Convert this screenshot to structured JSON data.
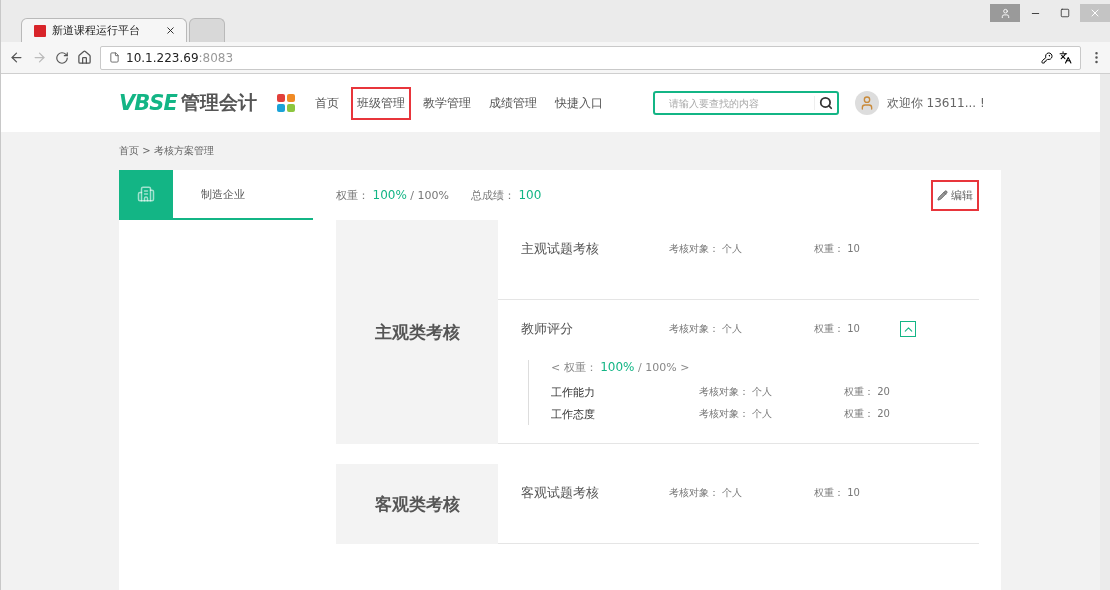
{
  "browser": {
    "tabs": [
      {
        "title": "新道课程运行平台",
        "selected": true
      },
      {
        "selected": false
      }
    ],
    "address": {
      "host": "10.1.223.69",
      "port": ":8083"
    }
  },
  "header": {
    "logo": {
      "brand": "VBSE",
      "name": "管理会计"
    },
    "nav": [
      {
        "label": "首页",
        "highlighted": false
      },
      {
        "label": "班级管理",
        "highlighted": true
      },
      {
        "label": "教学管理",
        "highlighted": false
      },
      {
        "label": "成绩管理",
        "highlighted": false
      },
      {
        "label": "快捷入口",
        "highlighted": false
      }
    ],
    "search": {
      "placeholder": "请输入要查找的内容"
    },
    "welcome": "欢迎你 13611... !"
  },
  "breadcrumb": "首页 > 考核方案管理",
  "sidebar": {
    "items": [
      {
        "label": "制造企业",
        "selected": true
      }
    ]
  },
  "summary": {
    "weight_label": "权重：",
    "weight_value": "100%",
    "weight_total": "/ 100%",
    "score_label": "总成绩：",
    "score_value": "100"
  },
  "edit_button": {
    "label": "编辑",
    "highlighted": true
  },
  "groups": [
    {
      "title": "主观类考核",
      "items": [
        {
          "name": "主观试题考核",
          "target_label": "考核对象：",
          "target": "个人",
          "weight_label": "权重：",
          "weight": "10"
        },
        {
          "name": "教师评分",
          "target_label": "考核对象：",
          "target": "个人",
          "weight_label": "权重：",
          "weight": "10",
          "expanded": true,
          "sub": {
            "weight_open": "< 权重：",
            "weight_value": "100%",
            "weight_close": "/ 100% >",
            "children": [
              {
                "name": "工作能力",
                "target_label": "考核对象：",
                "target": "个人",
                "weight_label": "权重：",
                "weight": "20"
              },
              {
                "name": "工作态度",
                "target_label": "考核对象：",
                "target": "个人",
                "weight_label": "权重：",
                "weight": "20"
              }
            ]
          }
        }
      ]
    },
    {
      "title": "客观类考核",
      "items": [
        {
          "name": "客观试题考核",
          "target_label": "考核对象：",
          "target": "个人",
          "weight_label": "权重：",
          "weight": "10"
        }
      ]
    }
  ]
}
